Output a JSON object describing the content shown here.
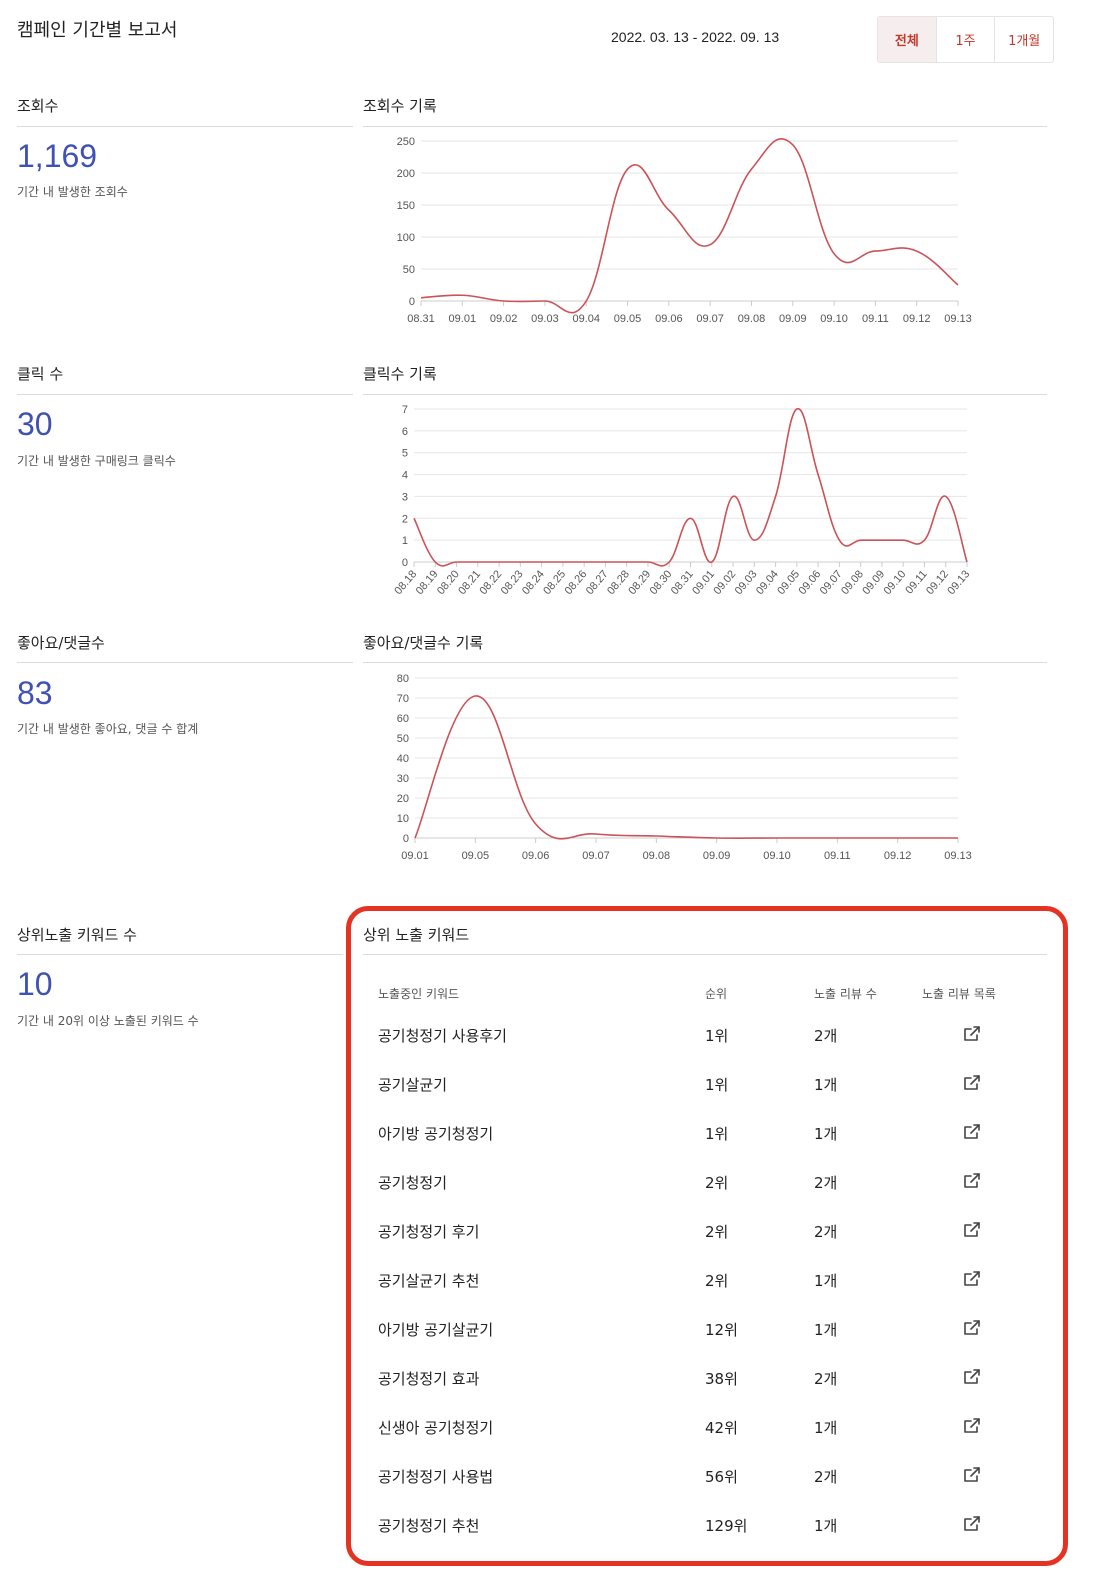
{
  "header": {
    "title": "캠페인 기간별 보고서",
    "date_range": "2022. 03. 13 - 2022. 09. 13",
    "periods": [
      {
        "label": "전체",
        "active": true
      },
      {
        "label": "1주",
        "active": false
      },
      {
        "label": "1개월",
        "active": false
      }
    ]
  },
  "views": {
    "label": "조회수",
    "value": "1,169",
    "description": "기간 내 발생한 조회수",
    "chart_title": "조회수 기록"
  },
  "clicks": {
    "label": "클릭 수",
    "value": "30",
    "description": "기간 내 발생한 구매링크 클릭수",
    "chart_title": "클릭수 기록"
  },
  "likes": {
    "label": "좋아요/댓글수",
    "value": "83",
    "description": "기간 내 발생한 좋아요, 댓글 수 합계",
    "chart_title": "좋아요/댓글수 기록"
  },
  "keywords": {
    "label": "상위노출 키워드 수",
    "value": "10",
    "description": "기간 내 20위 이상 노출된 키워드 수",
    "table_title": "상위 노출 키워드",
    "columns": [
      "노출중인 키워드",
      "순위",
      "노출 리뷰 수",
      "노출 리뷰 목록"
    ],
    "link_icon": "external-link-icon",
    "rows": [
      {
        "keyword": "공기청정기 사용후기",
        "rank": "1위",
        "reviews": "2개"
      },
      {
        "keyword": "공기살균기",
        "rank": "1위",
        "reviews": "1개"
      },
      {
        "keyword": "아기방 공기청정기",
        "rank": "1위",
        "reviews": "1개"
      },
      {
        "keyword": "공기청정기",
        "rank": "2위",
        "reviews": "2개"
      },
      {
        "keyword": "공기청정기 후기",
        "rank": "2위",
        "reviews": "2개"
      },
      {
        "keyword": "공기살균기 추천",
        "rank": "2위",
        "reviews": "1개"
      },
      {
        "keyword": "아기방 공기살균기",
        "rank": "12위",
        "reviews": "1개"
      },
      {
        "keyword": "공기청정기 효과",
        "rank": "38위",
        "reviews": "2개"
      },
      {
        "keyword": "신생아 공기청정기",
        "rank": "42위",
        "reviews": "1개"
      },
      {
        "keyword": "공기청정기 사용법",
        "rank": "56위",
        "reviews": "2개"
      },
      {
        "keyword": "공기청정기 추천",
        "rank": "129위",
        "reviews": "1개"
      }
    ]
  },
  "colors": {
    "accent_line": "#cc5257",
    "metric_value": "#3f51b5",
    "active_period": "#c0392b",
    "highlight_box": "#e53323"
  },
  "chart_data": [
    {
      "type": "line",
      "x": [
        "08.31",
        "09.01",
        "09.02",
        "09.03",
        "09.04",
        "09.05",
        "09.06",
        "09.07",
        "09.08",
        "09.09",
        "09.10",
        "09.11",
        "09.12",
        "09.13"
      ],
      "series": [
        {
          "values": [
            5,
            9,
            0,
            0,
            0,
            206,
            142,
            88,
            206,
            244,
            74,
            78,
            78,
            25
          ]
        }
      ],
      "ylim": [
        0,
        250
      ],
      "yticks": [
        0,
        50,
        100,
        150,
        200,
        250
      ],
      "grid": true
    },
    {
      "type": "line",
      "x": [
        "08.18",
        "08.19",
        "08.20",
        "08.21",
        "08.22",
        "08.23",
        "08.24",
        "08.25",
        "08.26",
        "08.27",
        "08.28",
        "08.29",
        "08.30",
        "08.31",
        "09.01",
        "09.02",
        "09.03",
        "09.04",
        "09.05",
        "09.06",
        "09.07",
        "09.08",
        "09.09",
        "09.10",
        "09.11",
        "09.12",
        "09.13"
      ],
      "series": [
        {
          "values": [
            2,
            0,
            0,
            0,
            0,
            0,
            0,
            0,
            0,
            0,
            0,
            0,
            0,
            2,
            0,
            3,
            1,
            3,
            7,
            4,
            1,
            1,
            1,
            1,
            1,
            3,
            0
          ]
        }
      ],
      "ylim": [
        0,
        7
      ],
      "yticks": [
        0,
        1,
        2,
        3,
        4,
        5,
        6,
        7
      ],
      "grid": true
    },
    {
      "type": "line",
      "x": [
        "09.01",
        "09.05",
        "09.06",
        "09.07",
        "09.08",
        "09.09",
        "09.10",
        "09.11",
        "09.12",
        "09.13"
      ],
      "series": [
        {
          "values": [
            0,
            71,
            7,
            2,
            1,
            0,
            0,
            0,
            0,
            0
          ]
        }
      ],
      "ylim": [
        0,
        80
      ],
      "yticks": [
        0,
        10,
        20,
        30,
        40,
        50,
        60,
        70,
        80
      ],
      "grid": true
    }
  ]
}
